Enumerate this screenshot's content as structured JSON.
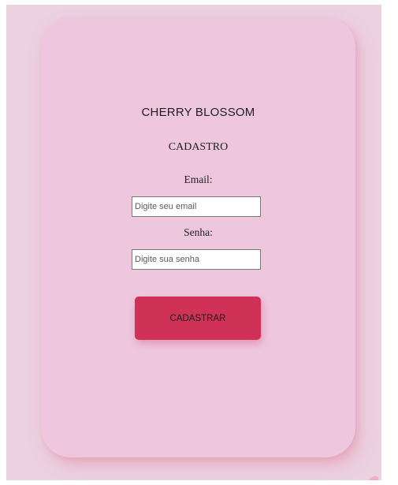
{
  "brand": {
    "title": "CHERRY BLOSSOM"
  },
  "form": {
    "title": "CADASTRO",
    "email_label": "Email:",
    "email_placeholder": "Digite seu email",
    "email_value": "",
    "password_label": "Senha:",
    "password_placeholder": "Digite sua senha",
    "password_value": "",
    "submit_label": "CADASTRAR"
  },
  "colors": {
    "page_background": "#ecd1e1",
    "card_background": "#eec7df",
    "button_background": "#cf3157",
    "card_shadow": "#e296aa"
  },
  "icons": {
    "decoration": "petal-icon"
  }
}
